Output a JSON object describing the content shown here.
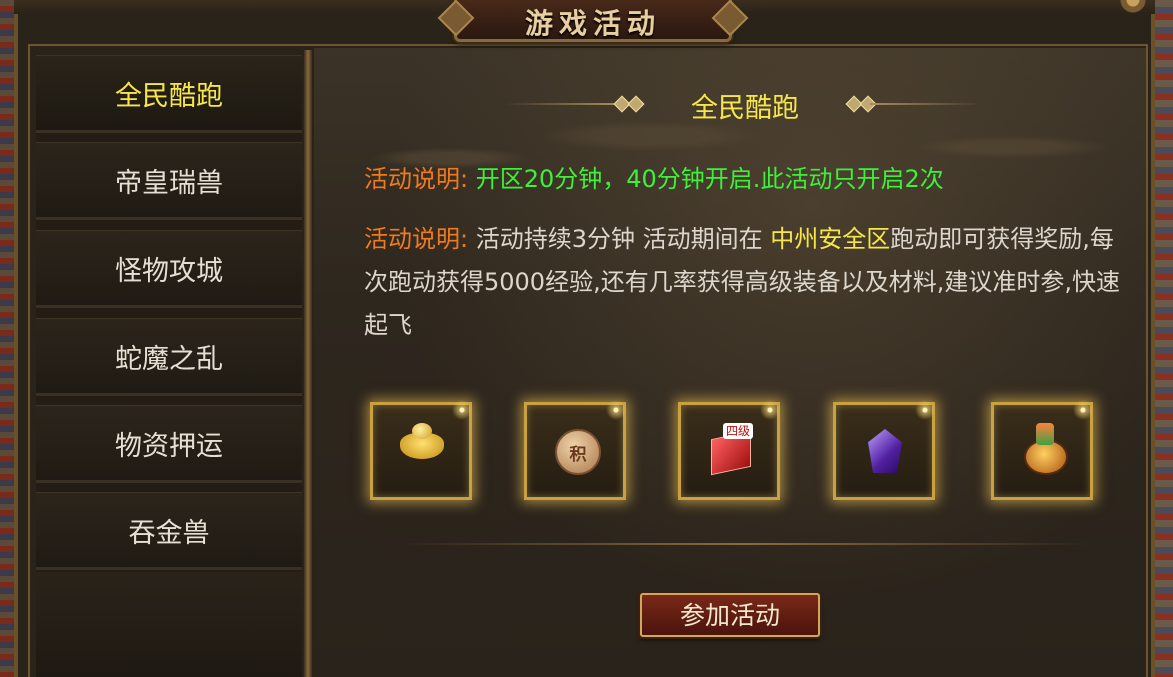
{
  "window": {
    "title": "游戏活动"
  },
  "sidebar": {
    "items": [
      {
        "label": "全民酷跑",
        "active": true
      },
      {
        "label": "帝皇瑞兽",
        "active": false
      },
      {
        "label": "怪物攻城",
        "active": false
      },
      {
        "label": "蛇魔之乱",
        "active": false
      },
      {
        "label": "物资押运",
        "active": false
      },
      {
        "label": "吞金兽",
        "active": false
      }
    ]
  },
  "activity": {
    "heading": "全民酷跑",
    "line1": {
      "label": "活动说明:",
      "text": "开区20分钟，40分钟开启.此活动只开启2次"
    },
    "line2": {
      "label": "活动说明:",
      "text_a": "活动持续3分钟 活动期间在 ",
      "location": "中州安全区",
      "text_b": "跑动即可获得奖励,每次跑动获得5000经验,还有几率获得高级装备以及材料,建议准时参,快速起飞"
    },
    "rewards": [
      {
        "icon": "gold-ingot-icon"
      },
      {
        "icon": "points-coin-icon",
        "glyph": "积"
      },
      {
        "icon": "level4-material-icon",
        "badge": "四级"
      },
      {
        "icon": "purple-gem-icon"
      },
      {
        "icon": "potion-pot-icon"
      }
    ]
  },
  "actions": {
    "join_label": "参加活动"
  },
  "colors": {
    "active_yellow": "#f6e64a",
    "label_orange": "#f07a20",
    "highlight_green": "#3ef03a",
    "frame_gold": "#c9a140"
  }
}
